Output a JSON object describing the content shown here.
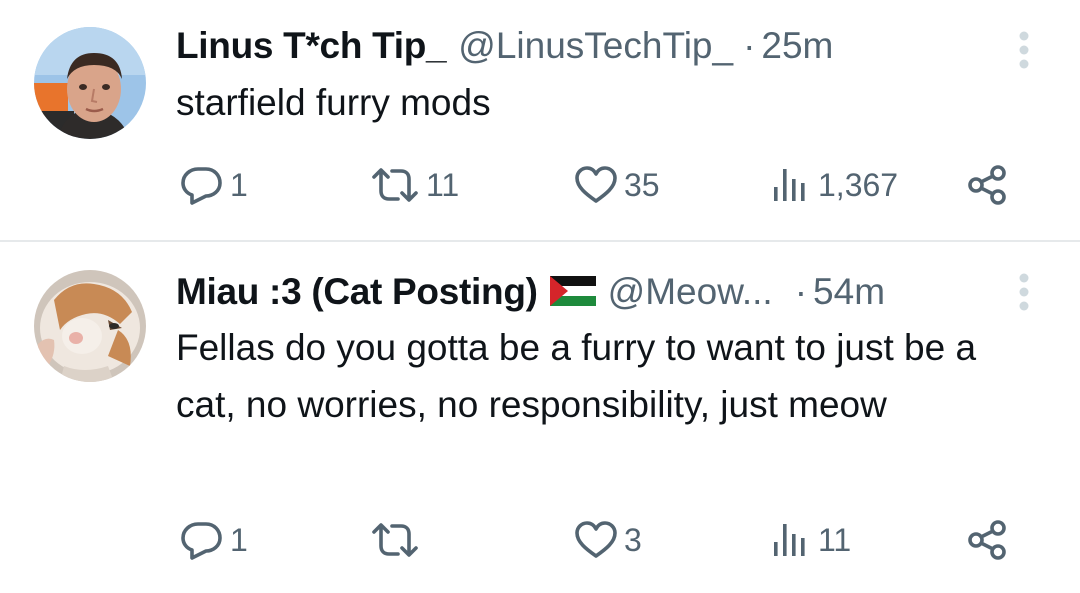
{
  "tweets": [
    {
      "display_name": "Linus T*ch Tip_",
      "handle": "@LinusTechTip_",
      "separator": "·",
      "time": "25m",
      "text": "starfield furry mods",
      "stats": {
        "replies": "1",
        "retweets": "11",
        "likes": "35",
        "views": "1,367"
      }
    },
    {
      "display_name": "Miau :3 (Cat Posting)",
      "handle": "@Meow...",
      "separator": "·",
      "time": "54m",
      "text": "Fellas do you gotta be a furry to want to just be a cat, no worries, no responsibility, just meow",
      "stats": {
        "replies": "1",
        "retweets": "",
        "likes": "3",
        "views": "11"
      }
    }
  ],
  "icons": {
    "reply": "reply-icon",
    "retweet": "retweet-icon",
    "like": "heart-icon",
    "views": "views-icon",
    "share": "share-icon",
    "more": "more-vertical-icon",
    "flag": "palestine-flag-icon"
  },
  "colors": {
    "text_primary": "#0f1419",
    "text_secondary": "#536471",
    "divider": "#e6e9eb",
    "more_dots": "#cfd9de"
  }
}
